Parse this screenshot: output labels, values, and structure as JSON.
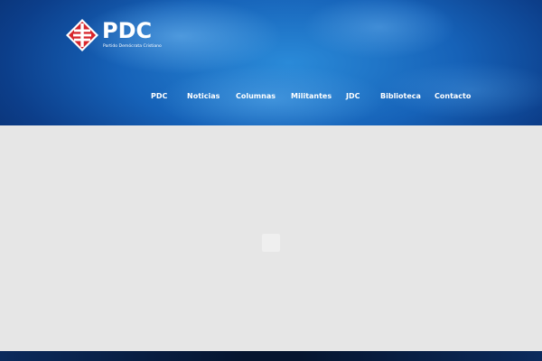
{
  "brand": {
    "name": "PDC",
    "subtitle": "Partido Demócrata Cristiano",
    "logo_icon": "pdc-cross-diamond-icon",
    "colors": {
      "logo_red": "#d7262c",
      "header_blue": "#1662b8",
      "page_gray": "#e6e6e6"
    }
  },
  "nav": {
    "items": [
      {
        "label": "PDC"
      },
      {
        "label": "Noticias"
      },
      {
        "label": "Columnas"
      },
      {
        "label": "Militantes"
      },
      {
        "label": "JDC"
      },
      {
        "label": "Biblioteca"
      },
      {
        "label": "Contacto"
      }
    ]
  }
}
